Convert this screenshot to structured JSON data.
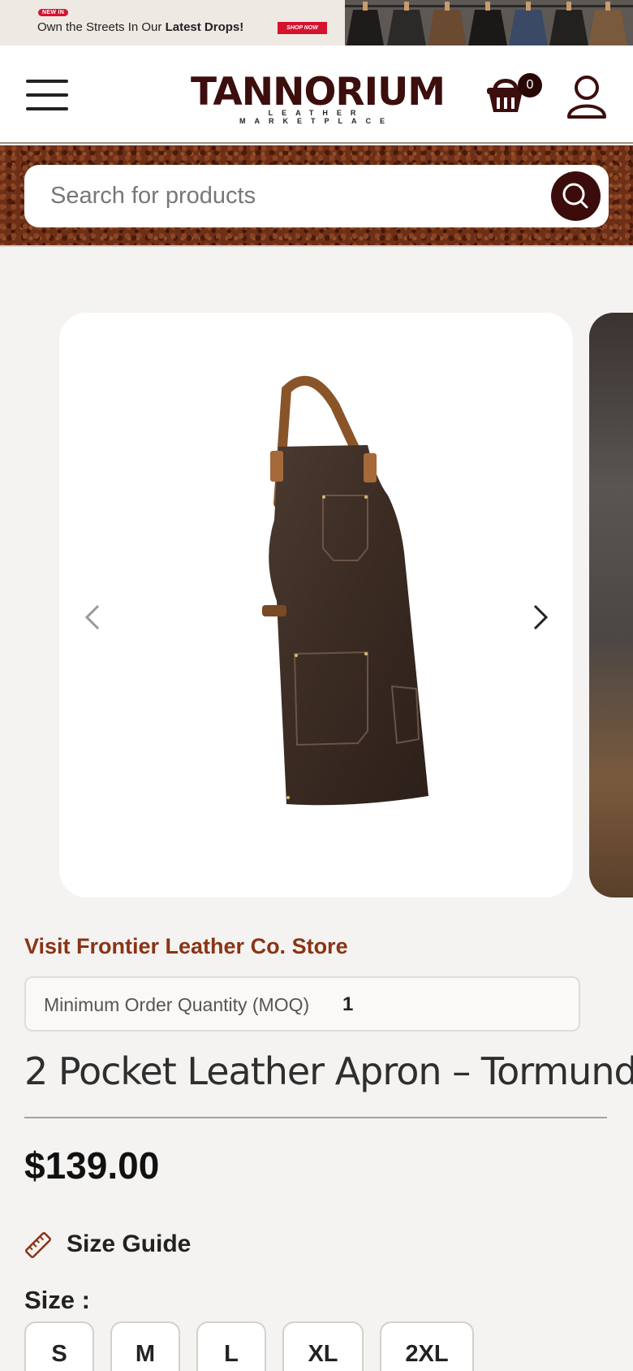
{
  "promo": {
    "badge": "NEW IN",
    "text_prefix": "Own the Streets In Our ",
    "text_bold": "Latest Drops!",
    "cta": "SHOP NOW"
  },
  "header": {
    "logo_word": "TANNORIUM",
    "logo_tagline": "LEATHER MARKETPLACE",
    "cart_count": "0",
    "brand_color": "#3c0e0e"
  },
  "search": {
    "placeholder": "Search for products"
  },
  "product": {
    "store_link": "Visit Frontier Leather Co. Store",
    "moq_label": "Minimum Order Quantity (MOQ)",
    "moq_value": "1",
    "title": "2 Pocket Leather Apron – Tormund",
    "price": "$139.00",
    "size_guide": "Size Guide",
    "size_label": "Size :",
    "sizes": [
      "S",
      "M",
      "L",
      "XL",
      "2XL"
    ],
    "accent_color": "#8a3415"
  }
}
